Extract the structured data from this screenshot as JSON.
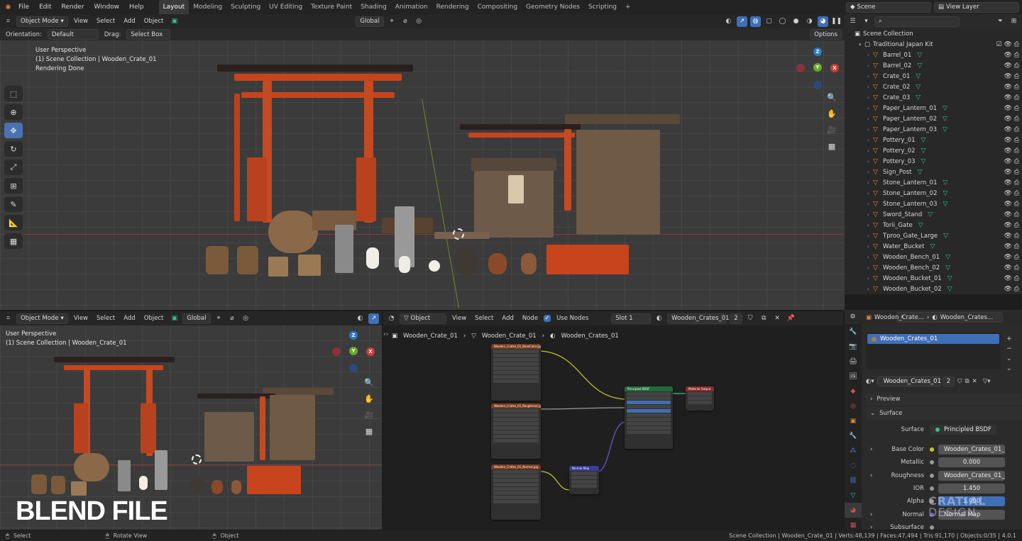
{
  "menu": {
    "items": [
      "File",
      "Edit",
      "Render",
      "Window",
      "Help"
    ],
    "workspaces": [
      "Layout",
      "Modeling",
      "Sculpting",
      "UV Editing",
      "Texture Paint",
      "Shading",
      "Animation",
      "Rendering",
      "Compositing",
      "Geometry Nodes",
      "Scripting"
    ],
    "active_workspace": "Layout",
    "add_tab": "+",
    "scene": "Scene",
    "view_layer": "View Layer"
  },
  "top_viewport": {
    "mode": "Object Mode",
    "menus": [
      "View",
      "Select",
      "Add",
      "Object"
    ],
    "transform": "Global",
    "orientation_label": "Orientation:",
    "orientation_value": "Default",
    "drag_label": "Drag:",
    "drag_value": "Select Box",
    "options": "Options",
    "info": [
      "User Perspective",
      "(1) Scene Collection | Wooden_Crate_01",
      "Rendering Done"
    ]
  },
  "bottom_viewport": {
    "mode": "Object Mode",
    "menus": [
      "View",
      "Select",
      "Add",
      "Object"
    ],
    "transform": "Global",
    "info": [
      "User Perspective",
      "(1) Scene Collection | Wooden_Crate_01"
    ],
    "watermark": "BLEND FILE"
  },
  "node_editor": {
    "type": "Object",
    "menus": [
      "View",
      "Select",
      "Add",
      "Node"
    ],
    "use_nodes_label": "Use Nodes",
    "slot": "Slot 1",
    "material": "Wooden_Crates_01",
    "users": "2",
    "breadcrumb": [
      "Wooden_Crate_01",
      "Wooden_Crate_01",
      "Wooden_Crates_01"
    ],
    "nodes": [
      {
        "title": "Wooden_Crates_01_BaseColor.jpg",
        "color": "#7a3a1e"
      },
      {
        "title": "Wooden_Crates_01_Roughness.jpg",
        "color": "#7a3a1e"
      },
      {
        "title": "Wooden_Crates_01_Normal.jpg",
        "color": "#7a3a1e"
      },
      {
        "title": "Normal Map",
        "color": "#3b3b9a"
      },
      {
        "title": "Principled BSDF",
        "color": "#1f6b3a"
      },
      {
        "title": "Material Output",
        "color": "#8a2a2a"
      }
    ]
  },
  "outliner": {
    "search_placeholder": "",
    "root": "Scene Collection",
    "collection": "Traditional Japan Kit",
    "items": [
      "Barrel_01",
      "Barrel_02",
      "Crate_01",
      "Crate_02",
      "Crate_03",
      "Paper_Lantern_01",
      "Paper_Lantern_02",
      "Paper_Lantern_03",
      "Pottery_01",
      "Pottery_02",
      "Pottery_03",
      "Sign_Post",
      "Stone_Lantern_01",
      "Stone_Lantern_02",
      "Stone_Lantern_03",
      "Sword_Stand",
      "Torii_Gate",
      "Tproo_Gate_Large",
      "Water_Bucket",
      "Wooden_Bench_01",
      "Wooden_Bench_02",
      "Wooden_Bucket_01",
      "Wooden_Bucket_02"
    ]
  },
  "properties": {
    "material_header": "Wooden_Crate...",
    "material_header2": "Wooden_Crates...",
    "slot_item": "Wooden_Crates_01",
    "material": "Wooden_Crates_01",
    "users": "2",
    "panels": [
      "Preview",
      "Surface"
    ],
    "surface_label": "Surface",
    "surface_value": "Principled BSDF",
    "rows": [
      {
        "label": "Base Color",
        "value": "Wooden_Crates_01_B..."
      },
      {
        "label": "Metallic",
        "value": "0.000"
      },
      {
        "label": "Roughness",
        "value": "Wooden_Crates_01_R..."
      },
      {
        "label": "IOR",
        "value": "1.450"
      },
      {
        "label": "Alpha",
        "value": "1.000"
      },
      {
        "label": "Normal",
        "value": "Normal Map"
      },
      {
        "label": "Subsurface",
        "value": ""
      }
    ],
    "watermark_line1": "CRATIAL",
    "watermark_line2": "DESIGN"
  },
  "status": {
    "select": "Select",
    "rotate": "Rotate View",
    "object": "Object",
    "stats": "Scene Collection | Wooden_Crate_01 | Verts:48,139 | Faces:47,494 | Tris:91,170 | Objects:0/35 | 4.0.1"
  },
  "colors": {
    "accent": "#4a72b3",
    "object": "#e0873b",
    "mesh": "#35c28b",
    "torii": "#d0461f"
  }
}
